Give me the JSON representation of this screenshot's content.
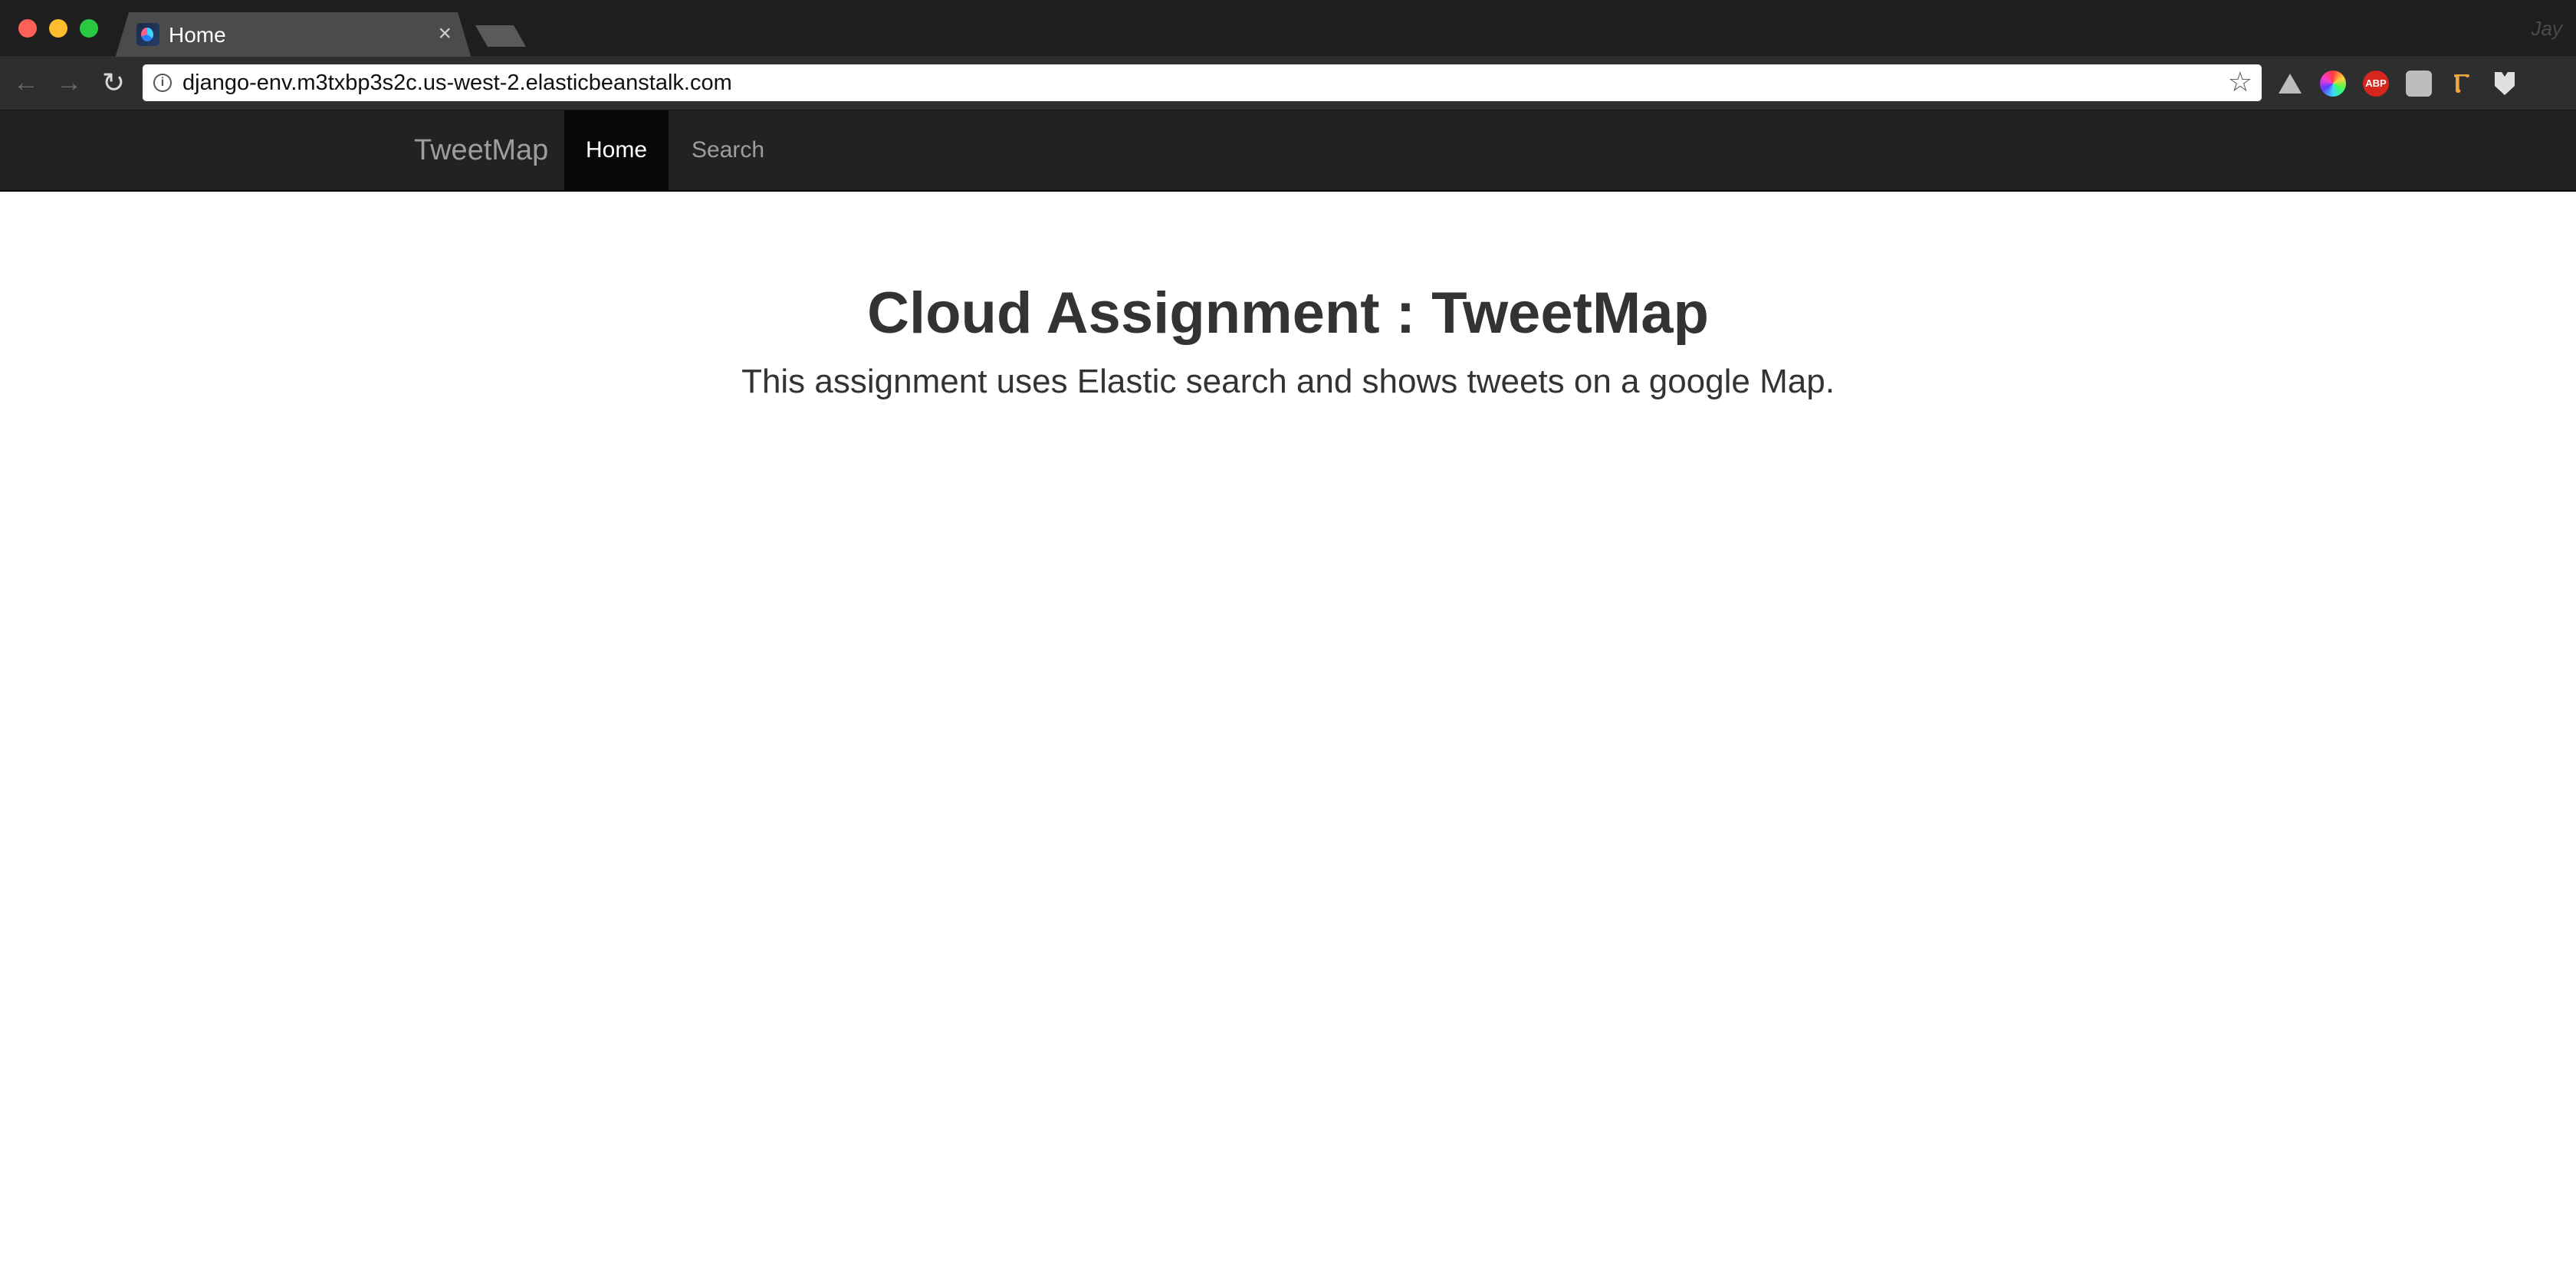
{
  "browser": {
    "tab": {
      "title": "Home",
      "close_glyph": "×"
    },
    "profile_name": "Jay",
    "url": "django-env.m3txbp3s2c.us-west-2.elasticbeanstalk.com",
    "icons": {
      "back": "back-arrow-icon",
      "forward": "forward-arrow-icon",
      "reload": "reload-icon",
      "info": "info-icon",
      "bookmark": "star-icon"
    },
    "extensions": {
      "abp_label": "ABP",
      "pin_glyph": "Ⲅ",
      "menu_glyph": "⋮"
    }
  },
  "navbar": {
    "brand": "TweetMap",
    "items": [
      {
        "label": "Home",
        "active": true
      },
      {
        "label": "Search",
        "active": false
      }
    ]
  },
  "hero": {
    "title": "Cloud Assignment : TweetMap",
    "subtitle": "This assignment uses Elastic search and shows tweets on a google Map."
  },
  "colors": {
    "navbar_bg": "#222222",
    "navbar_active_bg": "#080808",
    "text": "#333333",
    "nav_link": "#9d9d9d"
  }
}
